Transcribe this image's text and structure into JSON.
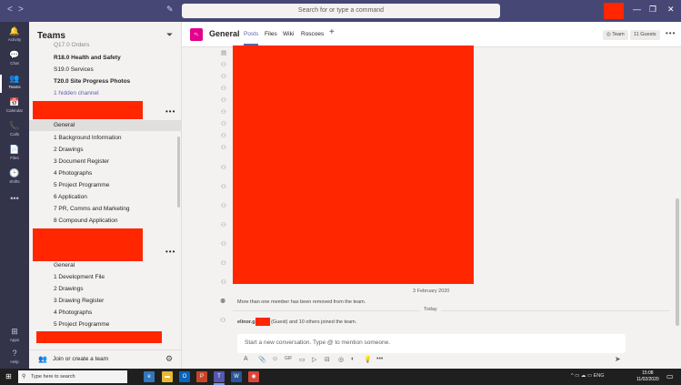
{
  "titlebar": {
    "back": "<",
    "forward": ">",
    "compose": "✎",
    "search_placeholder": "Search for or type a command",
    "minimize": "—",
    "maximize": "❐",
    "close": "✕"
  },
  "rail": [
    {
      "label": "Activity",
      "icon": "🔔"
    },
    {
      "label": "Chat",
      "icon": "💬"
    },
    {
      "label": "Teams",
      "icon": "👥"
    },
    {
      "label": "Calendar",
      "icon": "📅"
    },
    {
      "label": "Calls",
      "icon": "📞"
    },
    {
      "label": "Files",
      "icon": "📄"
    },
    {
      "label": "Shifts",
      "icon": "🕑"
    },
    {
      "label": "",
      "icon": "•••"
    },
    {
      "label": "Apps",
      "icon": "⊞"
    },
    {
      "label": "Help",
      "icon": "?"
    }
  ],
  "sidebar": {
    "title": "Teams",
    "team1_channels": [
      "Q17.0 Orders",
      "R18.0 Health and Safety",
      "S19.0 Services",
      "T20.0 Site Progress Photos",
      "1 hidden channel"
    ],
    "team2_channels": [
      "General",
      "1 Background Information",
      "2 Drawings",
      "3 Document Register",
      "4 Photographs",
      "5 Project Programme",
      "6 Application",
      "7 PR, Comms and Marketing",
      "8 Compound Application"
    ],
    "team3_channels": [
      "General",
      "1 Development File",
      "2 Drawings",
      "3 Drawing Register",
      "4 Photographs",
      "5 Project Programme"
    ],
    "more": "•••",
    "join_label": "Join or create a team"
  },
  "header": {
    "team_initials": "TL",
    "channel_name": "General",
    "tabs": [
      "Posts",
      "Files",
      "Wiki",
      "Roscoes"
    ],
    "add_tab": "+",
    "team_chip": "Team",
    "guests_chip": "11 Guests",
    "more": "•••"
  },
  "posts": {
    "date_label": "3 February 2020",
    "removed_msg": "More than one member has been removed from the team.",
    "today_label": "Today",
    "joined_name": "elinor.g",
    "joined_rest": "(Guest) and 10 others joined the team."
  },
  "compose": {
    "placeholder": "Start a new conversation. Type @ to mention someone.",
    "tools": [
      "A",
      "📎",
      "☺",
      "GIF",
      "▭",
      "▷",
      "⊟",
      "◎",
      "◐",
      "💡",
      "•••"
    ],
    "send": "➤"
  },
  "taskbar": {
    "search_placeholder": "Type here to search",
    "apps": [
      {
        "name": "edge",
        "glyph": "e",
        "color": "#3277bc"
      },
      {
        "name": "file-explorer",
        "glyph": "▬",
        "color": "#e8b930"
      },
      {
        "name": "outlook",
        "glyph": "O",
        "color": "#0a64b8"
      },
      {
        "name": "powerpoint",
        "glyph": "P",
        "color": "#c4462a"
      },
      {
        "name": "teams",
        "glyph": "T",
        "color": "#5558af"
      },
      {
        "name": "word",
        "glyph": "W",
        "color": "#2a5699"
      },
      {
        "name": "chrome",
        "glyph": "◉",
        "color": "#db4437"
      }
    ],
    "tray": "^ ▭ ☁ ▭ ENG",
    "time": "15:08",
    "date": "11/02/2020"
  }
}
